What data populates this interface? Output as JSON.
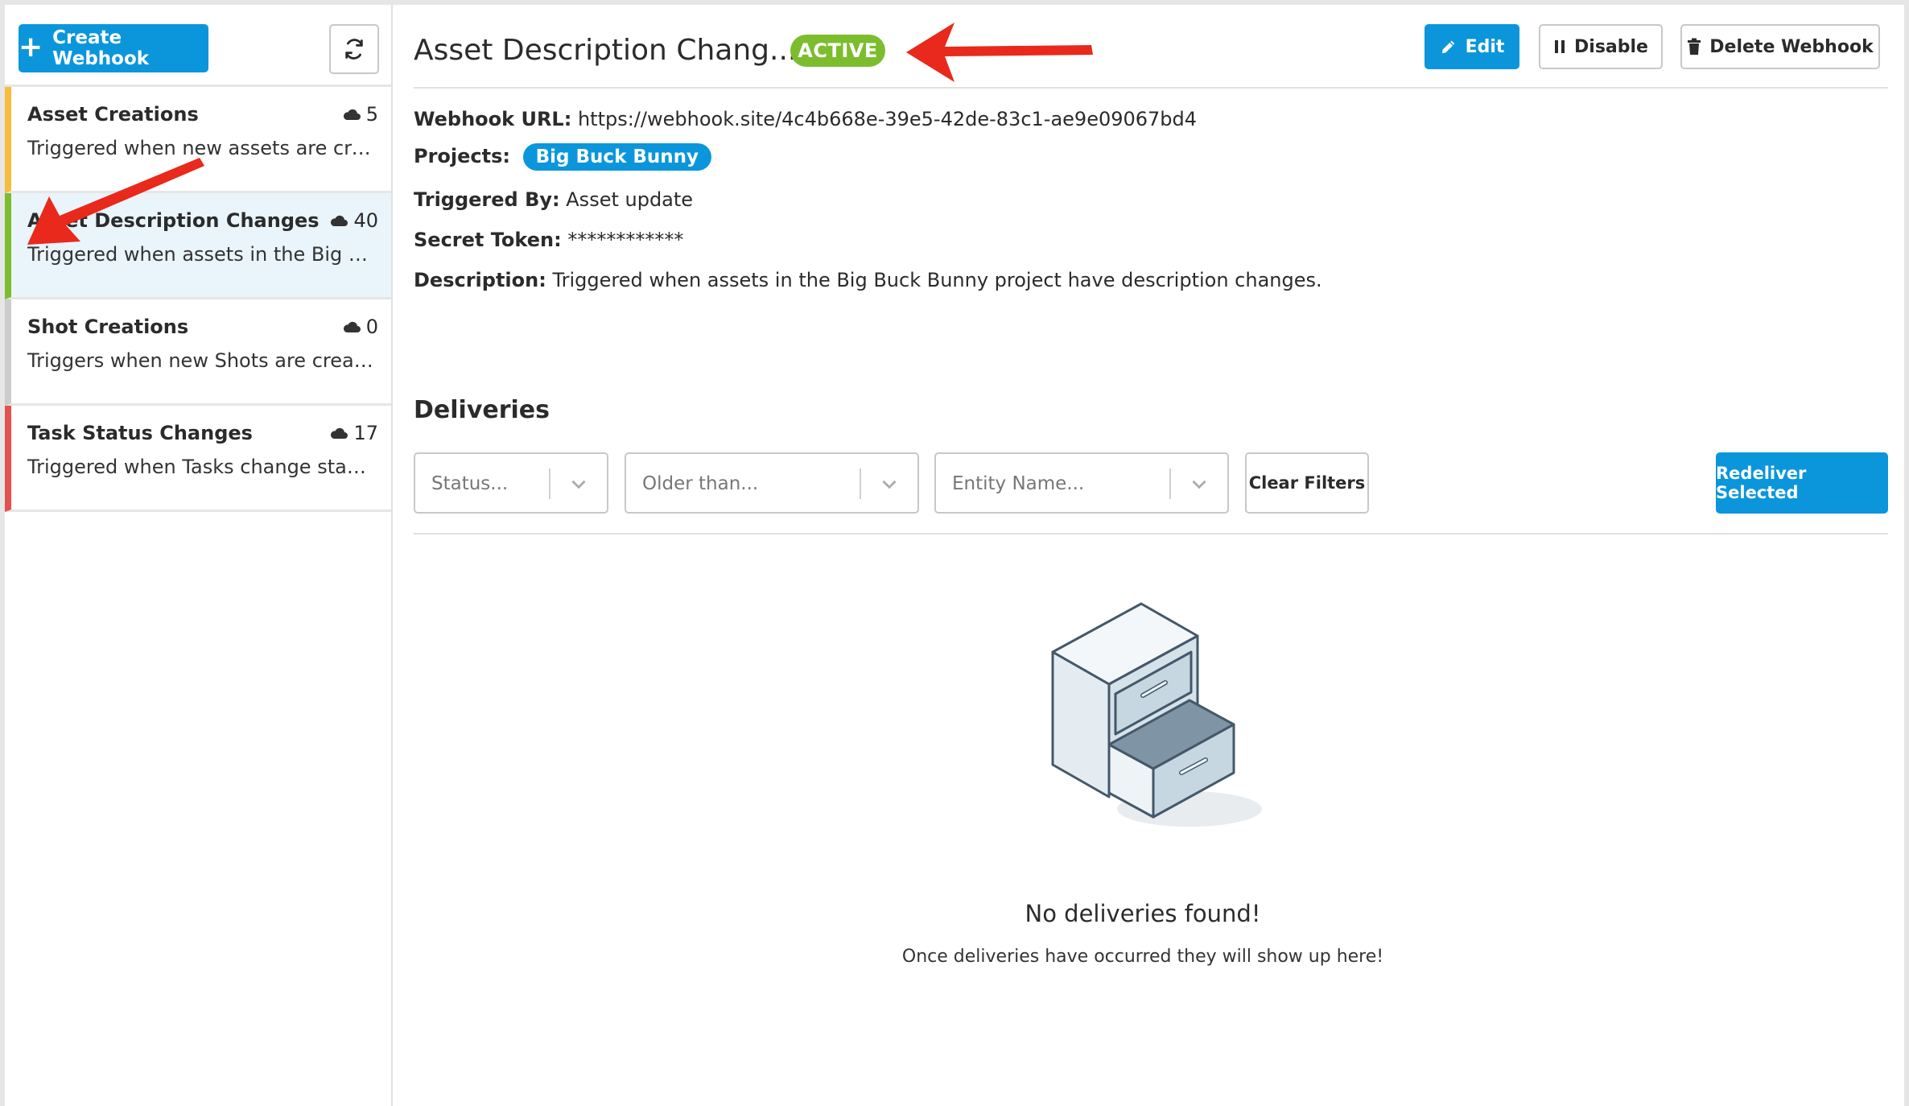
{
  "sidebar": {
    "create_label": "Create Webhook",
    "items": [
      {
        "title": "Asset Creations",
        "count": "5",
        "desc": "Triggered when new assets are created.",
        "accent": "#f5bd3b"
      },
      {
        "title": "Asset Description Changes",
        "count": "40",
        "desc": "Triggered when assets in the Big Buck Bunny project have description changes.",
        "accent": "#7cbd2e"
      },
      {
        "title": "Shot Creations",
        "count": "0",
        "desc": "Triggers when new Shots are created.",
        "accent": "#cccccc"
      },
      {
        "title": "Task Status Changes",
        "count": "17",
        "desc": "Triggered when Tasks change status.",
        "accent": "#e5504f"
      }
    ]
  },
  "header": {
    "title": "Asset Description Chang...",
    "status": "ACTIVE",
    "edit_label": "Edit",
    "disable_label": "Disable",
    "delete_label": "Delete Webhook"
  },
  "details": {
    "url_label": "Webhook URL:",
    "url": "https://webhook.site/4c4b668e-39e5-42de-83c1-ae9e09067bd4",
    "projects_label": "Projects:",
    "project": "Big Buck Bunny",
    "triggered_label": "Triggered By:",
    "triggered": "Asset update",
    "token_label": "Secret Token:",
    "token": "************",
    "desc_label": "Description:",
    "desc": "Triggered when assets in the Big Buck Bunny project have description changes."
  },
  "deliveries": {
    "title": "Deliveries",
    "status_ph": "Status...",
    "older_ph": "Older than...",
    "entity_ph": "Entity Name...",
    "clear_label": "Clear Filters",
    "redeliver_label": "Redeliver Selected",
    "empty_title": "No deliveries found!",
    "empty_sub": "Once deliveries have occurred they will show up here!"
  },
  "colors": {
    "primary": "#0b96db",
    "active": "#7cbd2e",
    "annotation": "#e8291c"
  },
  "icons": [
    "plus-icon",
    "refresh-icon",
    "cloud-icon",
    "pencil-icon",
    "pause-icon",
    "trash-icon",
    "chevron-down-icon",
    "file-cabinet-icon",
    "annotation-arrow"
  ]
}
